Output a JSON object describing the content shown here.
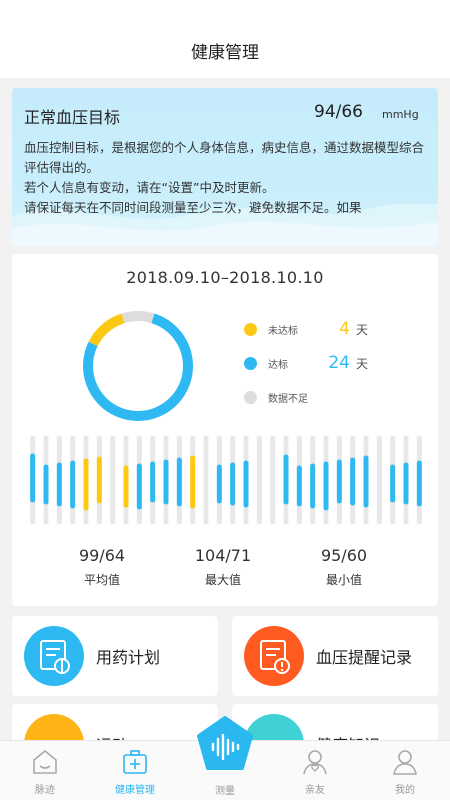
{
  "header": {
    "title": "健康管理"
  },
  "target": {
    "title": "正常血压目标",
    "value": "94/66",
    "unit": "mmHg",
    "description": "血压控制目标，是根据您的个人身体信息，病史信息，通过数据模型综合评估得出的。\n若个人信息有变动，请在“设置”中及时更新。\n请保证每天在不同时间段测量至少三次，避免数据不足。如果"
  },
  "stats": {
    "date_range": "2018.09.10–2018.10.10",
    "legend": [
      {
        "label": "未达标",
        "count": "4",
        "unit": "天",
        "color": "#fbc914"
      },
      {
        "label": "达标",
        "count": "24",
        "unit": "天",
        "color": "#2fb9f3"
      },
      {
        "label": "数据不足",
        "count": "",
        "unit": "",
        "color": "#dddddd"
      }
    ],
    "donut": {
      "unmet": 4,
      "met": 24,
      "insufficient": 3
    },
    "daily_status": [
      "met",
      "met",
      "met",
      "met",
      "unmet",
      "unmet",
      "none",
      "unmet",
      "met",
      "met",
      "met",
      "met",
      "unmet",
      "none",
      "met",
      "met",
      "met",
      "none",
      "none",
      "met",
      "met",
      "met",
      "met",
      "met",
      "met",
      "met",
      "none",
      "met",
      "met",
      "met"
    ],
    "summary": [
      {
        "value": "99/64",
        "label": "平均值"
      },
      {
        "value": "104/71",
        "label": "最大值"
      },
      {
        "value": "95/60",
        "label": "最小值"
      }
    ]
  },
  "features": [
    {
      "label": "用药计划",
      "icon": "medication-icon",
      "color": "#2fb9f3"
    },
    {
      "label": "血压提醒记录",
      "icon": "bp-alert-icon",
      "color": "#ff5a1f"
    },
    {
      "label": "运动",
      "icon": "exercise-icon",
      "color": "#fdb414"
    },
    {
      "label": "健康知识",
      "icon": "knowledge-icon",
      "color": "#3fd1d4"
    }
  ],
  "tabbar": {
    "tabs": [
      {
        "label": "脉迹",
        "icon": "home-icon"
      },
      {
        "label": "健康管理",
        "icon": "medkit-icon",
        "active": true
      },
      {
        "label": "测量",
        "icon": "measure-icon"
      },
      {
        "label": "亲友",
        "icon": "family-icon"
      },
      {
        "label": "我的",
        "icon": "profile-icon"
      }
    ]
  }
}
